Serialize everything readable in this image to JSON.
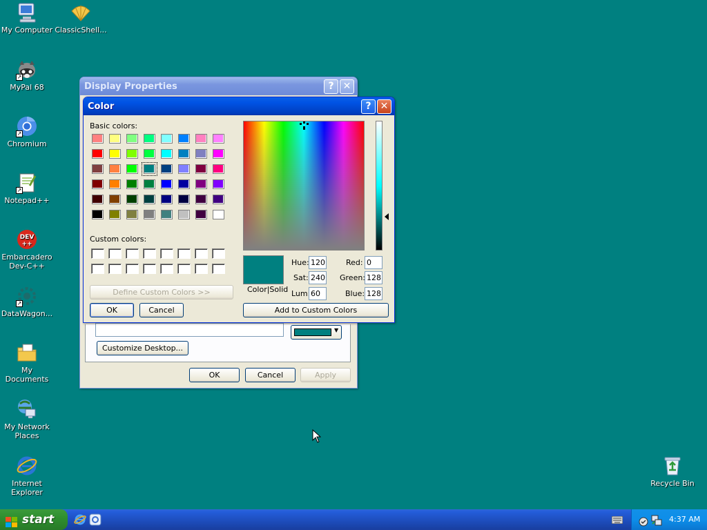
{
  "desktop": {
    "icons": [
      {
        "label": "My Computer"
      },
      {
        "label": "ClassicShell..."
      },
      {
        "label": "MyPal 68"
      },
      {
        "label": "Chromium"
      },
      {
        "label": "Notepad++"
      },
      {
        "label": "Embarcadero Dev-C++"
      },
      {
        "label": "DataWagon..."
      },
      {
        "label": "My Documents"
      },
      {
        "label": "My Network Places"
      },
      {
        "label": "Internet Explorer"
      },
      {
        "label": "Recycle Bin"
      }
    ]
  },
  "display_properties": {
    "title": "Display Properties",
    "help_glyph": "?",
    "close_glyph": "✕",
    "customize_desktop_label": "Customize Desktop...",
    "ok_label": "OK",
    "cancel_label": "Cancel",
    "apply_label": "Apply",
    "color_button_value": "#008080"
  },
  "color_dialog": {
    "title": "Color",
    "help_glyph": "?",
    "close_glyph": "✕",
    "basic_colors_label": "Basic colors:",
    "custom_colors_label": "Custom colors:",
    "define_custom_label": "Define Custom Colors >>",
    "ok_label": "OK",
    "cancel_label": "Cancel",
    "color_solid_label": "Color|Solid",
    "add_custom_label": "Add to Custom Colors",
    "hue_label": "Hue:",
    "hue_value": "120",
    "sat_label": "Sat:",
    "sat_value": "240",
    "lum_label": "Lum:",
    "lum_value": "60",
    "red_label": "Red:",
    "red_value": "0",
    "green_label": "Green:",
    "green_value": "128",
    "blue_label": "Blue:",
    "blue_value": "128",
    "selected_color": "#008080",
    "basic_colors": [
      [
        "#ff8080",
        "#ffff80",
        "#80ff80",
        "#00ff80",
        "#80ffff",
        "#0080ff",
        "#ff80c0",
        "#ff80ff"
      ],
      [
        "#ff0000",
        "#ffff00",
        "#80ff00",
        "#00ff40",
        "#00ffff",
        "#0080c0",
        "#8080c0",
        "#ff00ff"
      ],
      [
        "#804040",
        "#ff8040",
        "#00ff00",
        "#008080",
        "#004080",
        "#8080ff",
        "#800040",
        "#ff0080"
      ],
      [
        "#800000",
        "#ff8000",
        "#008000",
        "#008040",
        "#0000ff",
        "#0000a0",
        "#800080",
        "#8000ff"
      ],
      [
        "#400000",
        "#804000",
        "#004000",
        "#004040",
        "#000080",
        "#000040",
        "#400040",
        "#400080"
      ],
      [
        "#000000",
        "#808000",
        "#808040",
        "#808080",
        "#408080",
        "#c0c0c0",
        "#400040",
        "#ffffff"
      ]
    ],
    "selected_swatch": {
      "row": 2,
      "col": 3
    }
  },
  "taskbar": {
    "start_label": "start",
    "clock": "4:37 AM"
  }
}
